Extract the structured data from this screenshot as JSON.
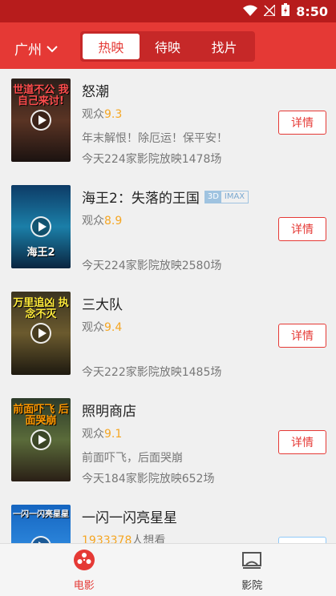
{
  "status": {
    "time": "8:50"
  },
  "header": {
    "city": "广州",
    "tabs": [
      {
        "label": "热映"
      },
      {
        "label": "待映"
      },
      {
        "label": "找片"
      }
    ]
  },
  "movies": [
    {
      "title": "怒潮",
      "audience_label": "观众",
      "score": "9.3",
      "tagline": "年末解恨！除厄运！保平安！",
      "showing": "今天224家影院放映1478场",
      "detail_label": "详情",
      "poster_text": "世道不公 我自己来讨!"
    },
    {
      "title": "海王2：失落的王国",
      "format_3d": "3D",
      "format_imax": "IMAX",
      "audience_label": "观众",
      "score": "8.9",
      "tagline": "",
      "showing": "今天224家影院放映2580场",
      "detail_label": "详情",
      "poster_text": "海王2"
    },
    {
      "title": "三大队",
      "audience_label": "观众",
      "score": "9.4",
      "tagline": "",
      "showing": "今天222家影院放映1485场",
      "detail_label": "详情",
      "poster_text": "万里追凶 执念不灭"
    },
    {
      "title": "照明商店",
      "audience_label": "观众",
      "score": "9.1",
      "tagline": "前面吓飞，后面哭崩",
      "showing": "今天184家影院放映652场",
      "detail_label": "详情",
      "poster_text": "前面吓飞 后面哭崩"
    },
    {
      "title": "一闪一闪亮星星",
      "want": "1933378",
      "want_suffix": "人想看",
      "poster_text": "一闪一闪亮星星"
    }
  ],
  "tabbar": {
    "items": [
      {
        "label": "电影"
      },
      {
        "label": "影院"
      }
    ]
  }
}
